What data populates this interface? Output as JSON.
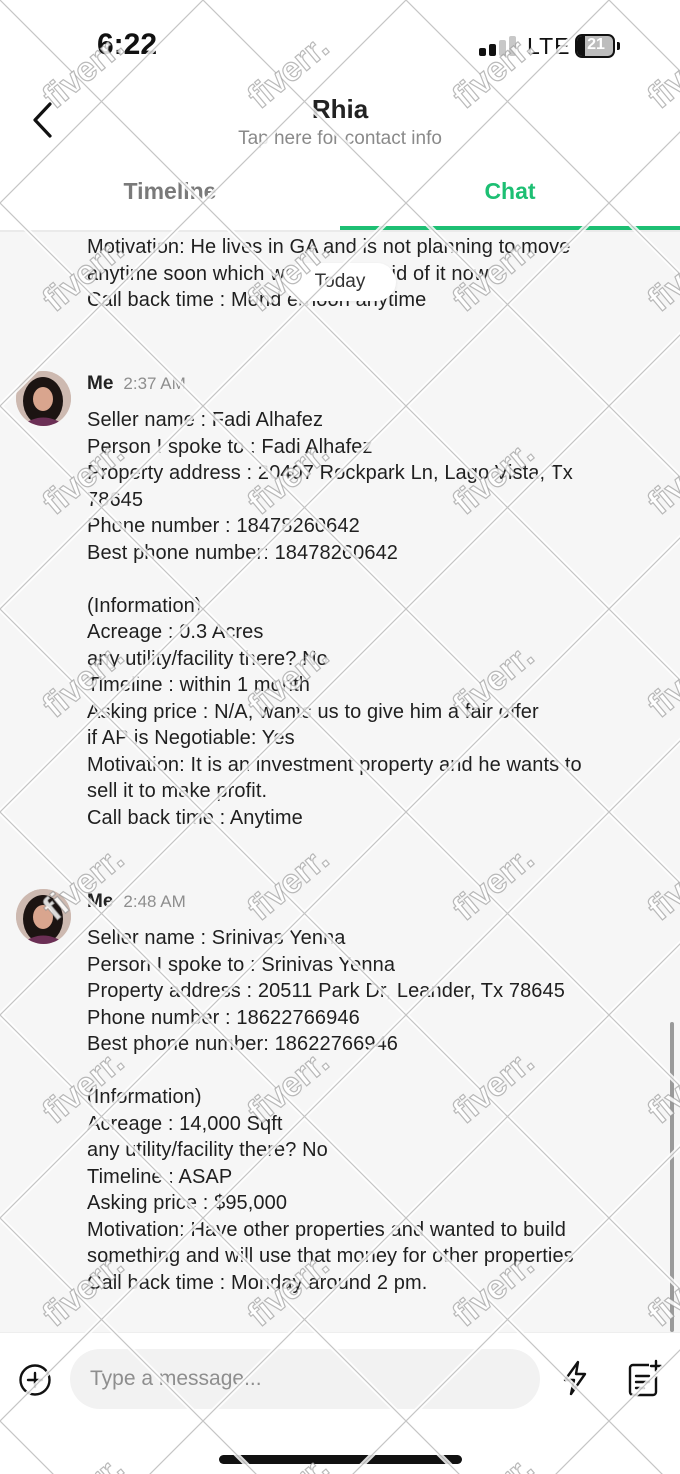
{
  "status_bar": {
    "time": "6:22",
    "network": "LTE",
    "battery": "21",
    "battery_level": 0.21
  },
  "header": {
    "contact_name": "Rhia",
    "contact_subtitle": "Tap here for contact info",
    "tabs": [
      {
        "label": "Timeline",
        "active": false
      },
      {
        "label": "Chat",
        "active": true
      }
    ],
    "accent_color": "#1dbf73"
  },
  "chat": {
    "previous_message_tail": "Motivation: He lives in GA and is not planning to move\nanytime soon which            wants to get rid of it now\nCall back time : Mond         ernoon anytime",
    "date_divider": "Today",
    "messages": [
      {
        "sender": "Me",
        "time": "2:37 AM",
        "text": "Seller name : Fadi Alhafez\nPerson I spoke to : Fadi Alhafez\nProperty address :  20407 Rockpark Ln, Lago Vista, Tx\n78645\nPhone number : 18478260642\nBest phone number: 18478260642\n\n(Information)\nAcreage : 0.3 Acres\nany utility/facility there? No\nTimeline : within 1 month\nAsking price : N/A, wants us to give him a fair offer\nif AP is Negotiable: Yes\nMotivation: It is an investment property and he wants to\nsell it to make profit.\nCall back time : Anytime"
      },
      {
        "sender": "Me",
        "time": "2:48 AM",
        "text": "Seller name : Srinivas Yenna\nPerson I spoke to : Srinivas Yenna\nProperty address :  20511 Park Dr, Leander, Tx 78645\nPhone number : 18622766946\nBest phone number: 18622766946\n\n(Information)\nAcreage : 14,000 Sqft\nany utility/facility there? No\nTimeline : ASAP\nAsking price : $95,000\nMotivation: Have other properties and wanted to build\nsomething and will use that money for other properties\nCall back time : Monday around 2 pm."
      }
    ]
  },
  "composer": {
    "placeholder": "Type a message...",
    "icons": [
      "plus-circle-icon",
      "lightning-bolt-icon",
      "note-plus-icon"
    ]
  },
  "watermark_text": "fiverr."
}
